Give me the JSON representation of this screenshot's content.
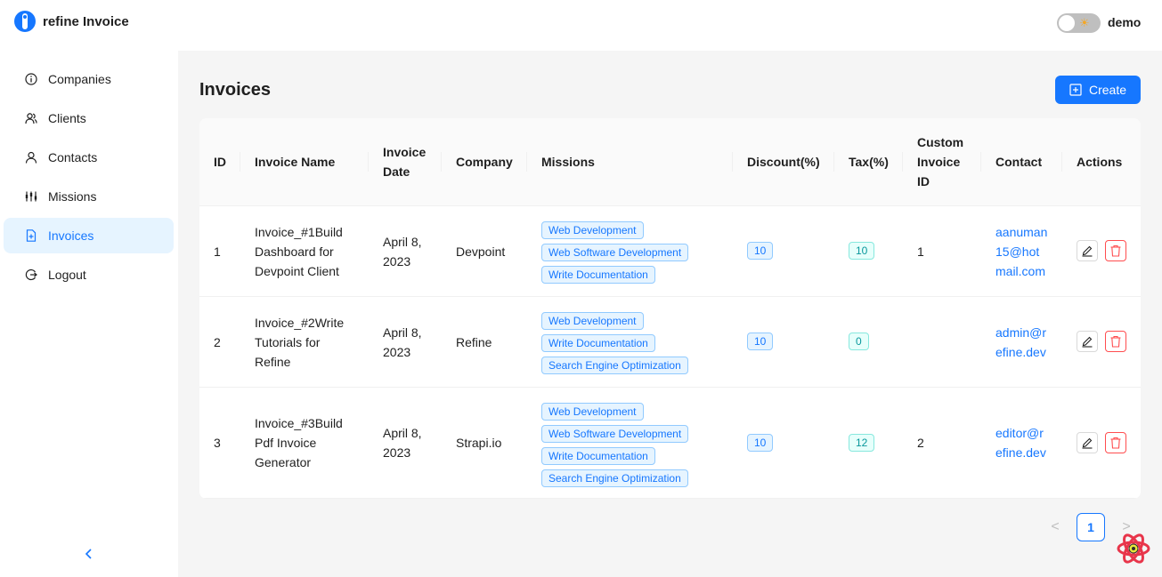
{
  "app": {
    "title": "refine Invoice",
    "user": "demo"
  },
  "sidebar": {
    "items": [
      {
        "label": "Companies",
        "icon": "info-circle-icon"
      },
      {
        "label": "Clients",
        "icon": "team-icon"
      },
      {
        "label": "Contacts",
        "icon": "user-icon"
      },
      {
        "label": "Missions",
        "icon": "sliders-icon"
      },
      {
        "label": "Invoices",
        "icon": "file-add-icon"
      },
      {
        "label": "Logout",
        "icon": "logout-icon"
      }
    ],
    "active": "Invoices",
    "collapse_glyph": "<"
  },
  "page": {
    "title": "Invoices",
    "create_label": "Create"
  },
  "table": {
    "columns": [
      "ID",
      "Invoice Name",
      "Invoice Date",
      "Company",
      "Missions",
      "Discount(%)",
      "Tax(%)",
      "Custom Invoice ID",
      "Contact",
      "Actions"
    ],
    "column_lines": {
      "invoice_date": [
        "Invoice",
        "Date"
      ],
      "custom_invoice_id": [
        "Custom",
        "Invoice",
        "ID"
      ]
    },
    "rows": [
      {
        "id": "1",
        "name_lines": [
          "Invoice_#1Build",
          "Dashboard for",
          "Devpoint Client"
        ],
        "date_lines": [
          "April 8,",
          "2023"
        ],
        "company": "Devpoint",
        "missions": [
          "Web Development",
          "Web Software Development",
          "Write Documentation"
        ],
        "discount": "10",
        "tax": "10",
        "custom_id": "1",
        "contact_lines": [
          "aanuman",
          "15@hot",
          "mail.com"
        ]
      },
      {
        "id": "2",
        "name_lines": [
          "Invoice_#2Write",
          "Tutorials for",
          "Refine"
        ],
        "date_lines": [
          "April 8,",
          "2023"
        ],
        "company": "Refine",
        "missions": [
          "Web Development",
          "Write Documentation",
          "Search Engine Optimization"
        ],
        "discount": "10",
        "tax": "0",
        "custom_id": "",
        "contact_lines": [
          "admin@r",
          "efine.dev"
        ]
      },
      {
        "id": "3",
        "name_lines": [
          "Invoice_#3Build",
          "Pdf Invoice",
          "Generator"
        ],
        "date_lines": [
          "April 8,",
          "2023"
        ],
        "company": "Strapi.io",
        "missions": [
          "Web Development",
          "Web Software Development",
          "Write Documentation",
          "Search Engine Optimization"
        ],
        "discount": "10",
        "tax": "12",
        "custom_id": "2",
        "contact_lines": [
          "editor@r",
          "efine.dev"
        ]
      }
    ]
  },
  "pagination": {
    "current": "1",
    "prev_glyph": "<",
    "next_glyph": ">"
  },
  "colors": {
    "primary": "#1677ff",
    "danger": "#ff4d4f",
    "tax_badge": "#08979c",
    "content_bg": "#f5f5f5"
  }
}
